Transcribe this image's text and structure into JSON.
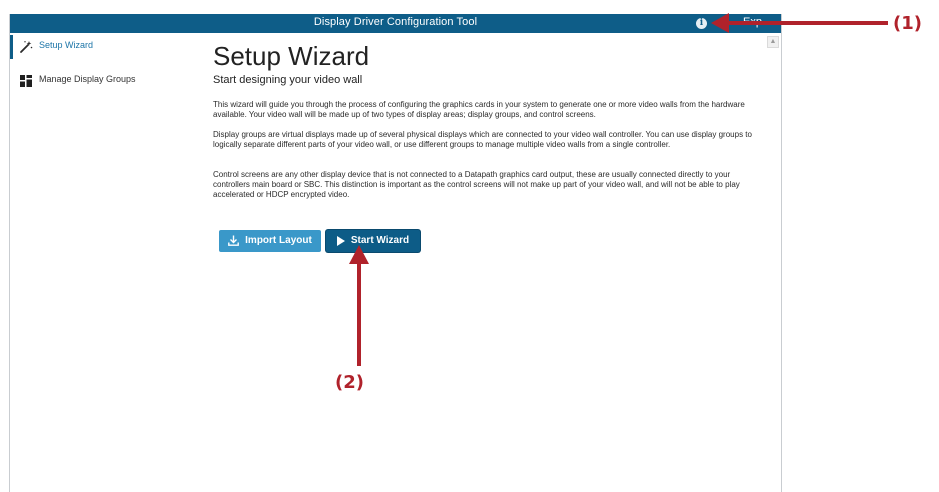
{
  "window": {
    "title": "Display Driver Configuration Tool",
    "info_icon": "info-circle-icon",
    "extra_menu_label": "Exp..."
  },
  "sidebar": {
    "items": [
      {
        "label": "Setup Wizard",
        "icon": "magic-wand-icon",
        "active": true
      },
      {
        "label": "Manage Display Groups",
        "icon": "display-groups-icon",
        "active": false
      }
    ]
  },
  "main": {
    "title": "Setup Wizard",
    "subtitle": "Start designing your video wall",
    "paragraphs": [
      "This wizard will guide you through the process of configuring the graphics cards in your system to generate one or more video walls from the hardware available. Your video wall will be made up of two types of display areas; display groups, and control screens.",
      "Display groups are virtual displays made up of several physical displays which are connected to your video wall controller. You can use display groups to logically separate different parts of your video wall, or use different groups to manage multiple video walls from a single controller.",
      "Control screens are any other display device that is not connected to a Datapath graphics card output, these are usually connected directly to your controllers main board or SBC. This distinction is important as the control screens will not make up part of your video wall, and will not be able to play accelerated or HDCP encrypted video."
    ],
    "buttons": {
      "import_label": "Import Layout",
      "start_label": "Start Wizard"
    }
  },
  "annotations": {
    "label_1": "(1)",
    "label_2": "(2)",
    "color": "#b0222b"
  },
  "colors": {
    "titlebar": "#0e5d88",
    "import_button": "#3a98c9",
    "start_button": "#0d5c87",
    "active_nav": "#1c75a8"
  }
}
